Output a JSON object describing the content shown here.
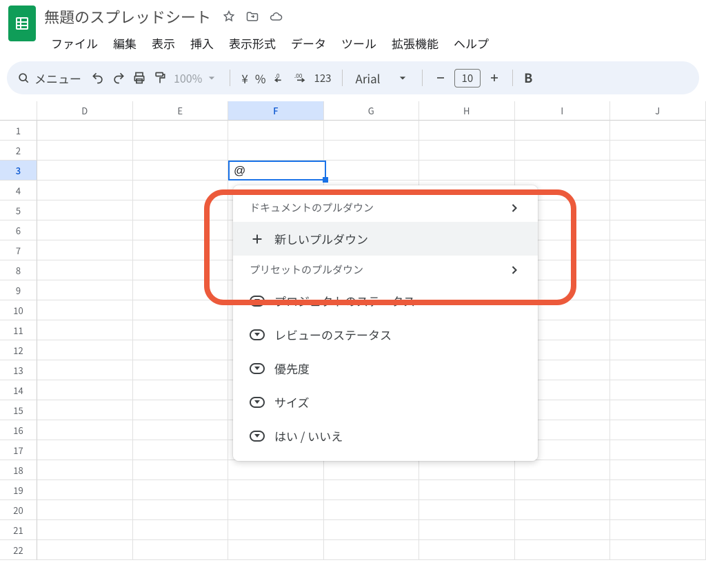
{
  "header": {
    "doc_title": "無題のスプレッドシート",
    "menu_items": [
      "ファイル",
      "編集",
      "表示",
      "挿入",
      "表示形式",
      "データ",
      "ツール",
      "拡張機能",
      "ヘルプ"
    ]
  },
  "toolbar": {
    "search_label": "メニュー",
    "zoom": "100%",
    "currency_symbol": "¥",
    "percent_symbol": "%",
    "decimal_dec": ".0",
    "decimal_inc": ".00",
    "number_format": "123",
    "font_name": "Arial",
    "font_size": "10",
    "bold": "B"
  },
  "sheet": {
    "columns": [
      "D",
      "E",
      "F",
      "G",
      "H",
      "I",
      "J"
    ],
    "active_col": "F",
    "rows": [
      1,
      2,
      3,
      4,
      5,
      6,
      7,
      8,
      9,
      10,
      11,
      12,
      13,
      14,
      15,
      16,
      17,
      18,
      19,
      20,
      21,
      22
    ],
    "active_row": 3,
    "active_cell_value": "@"
  },
  "popup": {
    "section1": "ドキュメントのプルダウン",
    "new_dropdown": "新しいプルダウン",
    "section2": "プリセットのプルダウン",
    "presets": [
      "プロジェクトのステータス",
      "レビューのステータス",
      "優先度",
      "サイズ",
      "はい / いいえ"
    ]
  }
}
